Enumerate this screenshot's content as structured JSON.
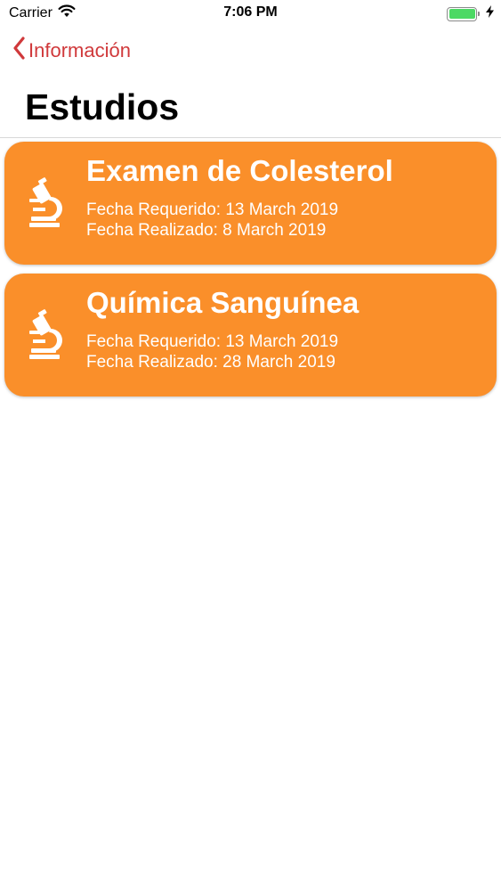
{
  "status_bar": {
    "carrier": "Carrier",
    "time": "7:06 PM",
    "battery_level": 1.0
  },
  "nav": {
    "back_label": "Información"
  },
  "page": {
    "title": "Estudios"
  },
  "studies": [
    {
      "name": "Examen de Colesterol",
      "required": "Fecha Requerido: 13 March 2019",
      "performed": "Fecha Realizado: 8 March 2019"
    },
    {
      "name": "Química Sanguínea",
      "required": "Fecha Requerido: 13 March 2019",
      "performed": "Fecha Realizado: 28 March 2019"
    }
  ],
  "colors": {
    "accent": "#d0393b",
    "card": "#fa8f2a",
    "battery": "#4cd964"
  }
}
